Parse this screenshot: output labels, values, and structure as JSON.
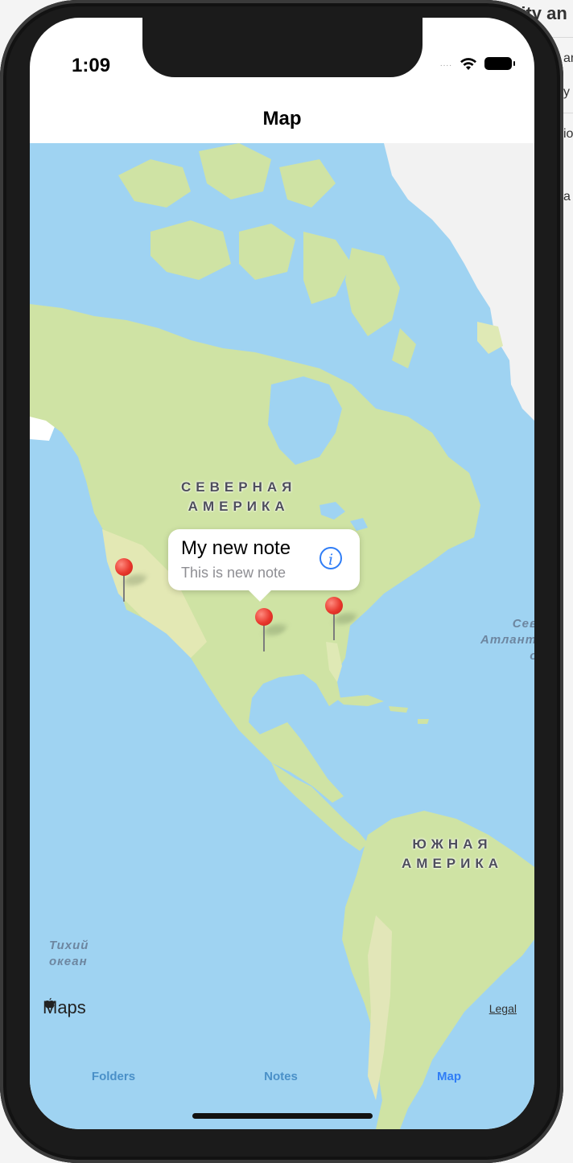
{
  "background_window": {
    "header_text": "tity an",
    "fragments": [
      "an",
      "y",
      "io",
      "a"
    ]
  },
  "status_bar": {
    "time": "1:09",
    "signal": "....",
    "wifi_icon": "wifi-icon",
    "battery_icon": "battery-icon"
  },
  "nav": {
    "title": "Map"
  },
  "map": {
    "regions": [
      {
        "line1": "СЕВЕРНАЯ",
        "line2": "АМЕРИКА"
      },
      {
        "line1": "ЮЖНАЯ",
        "line2": "АМЕРИКА"
      }
    ],
    "oceans": [
      {
        "line1": "Тихий",
        "line2": "океан"
      },
      {
        "line1": "Севе",
        "line2": "Атланти",
        "line3": "ок"
      }
    ],
    "callout": {
      "title": "My new note",
      "subtitle": "This is new note",
      "icon": "info-icon"
    },
    "pins": [
      "pin-west-coast",
      "pin-central",
      "pin-east"
    ],
    "logo": {
      "icon": "apple-icon",
      "text": "Maps"
    },
    "legal": "Legal"
  },
  "tabbar": {
    "tabs": [
      {
        "label": "Folders",
        "active": false
      },
      {
        "label": "Notes",
        "active": false
      },
      {
        "label": "Map",
        "active": true
      }
    ]
  },
  "colors": {
    "water": "#9fd3f2",
    "land": "#cfe3a4",
    "tint": "#2f7df6",
    "pin": "#e8382d"
  }
}
